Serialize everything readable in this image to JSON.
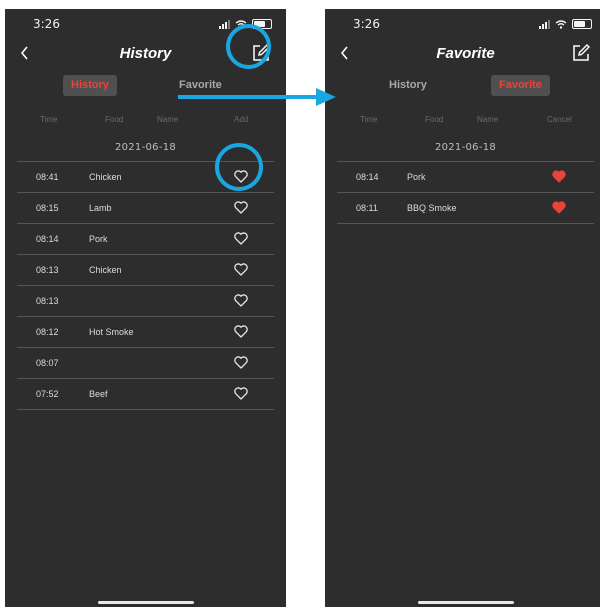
{
  "left": {
    "status_time": "3:26",
    "title": "History",
    "tabs": [
      "History",
      "Favorite"
    ],
    "active_tab": "History",
    "columns": [
      "Time",
      "Food",
      "Name",
      "Add"
    ],
    "date": "2021-06-18",
    "rows": [
      {
        "time": "08:41",
        "food": "Chicken",
        "icon": "heart-outline-icon"
      },
      {
        "time": "08:15",
        "food": "Lamb",
        "icon": "heart-outline-icon"
      },
      {
        "time": "08:14",
        "food": "Pork",
        "icon": "heart-outline-icon"
      },
      {
        "time": "08:13",
        "food": "Chicken",
        "icon": "heart-outline-icon"
      },
      {
        "time": "08:13",
        "food": "",
        "icon": "heart-outline-icon"
      },
      {
        "time": "08:12",
        "food": "Hot Smoke",
        "icon": "heart-outline-icon"
      },
      {
        "time": "08:07",
        "food": "",
        "icon": "heart-outline-icon"
      },
      {
        "time": "07:52",
        "food": "Beef",
        "icon": "heart-outline-icon"
      }
    ]
  },
  "right": {
    "status_time": "3:26",
    "title": "Favorite",
    "tabs": [
      "History",
      "Favorite"
    ],
    "active_tab": "Favorite",
    "columns": [
      "Time",
      "Food",
      "Name",
      "Cancel"
    ],
    "date": "2021-06-18",
    "rows": [
      {
        "time": "08:14",
        "food": "Pork",
        "icon": "heart-filled-icon"
      },
      {
        "time": "08:11",
        "food": "BBQ Smoke",
        "icon": "heart-filled-icon"
      }
    ]
  },
  "colors": {
    "background": "#2d2d2d",
    "accent_red": "#e8443a",
    "highlight_blue": "#1aa6e0",
    "divider": "#555555"
  },
  "icons": {
    "back": "chevron-left-icon",
    "edit": "edit-pencil-icon",
    "annotation": "circle-highlight",
    "flow": "arrow-right-icon"
  }
}
